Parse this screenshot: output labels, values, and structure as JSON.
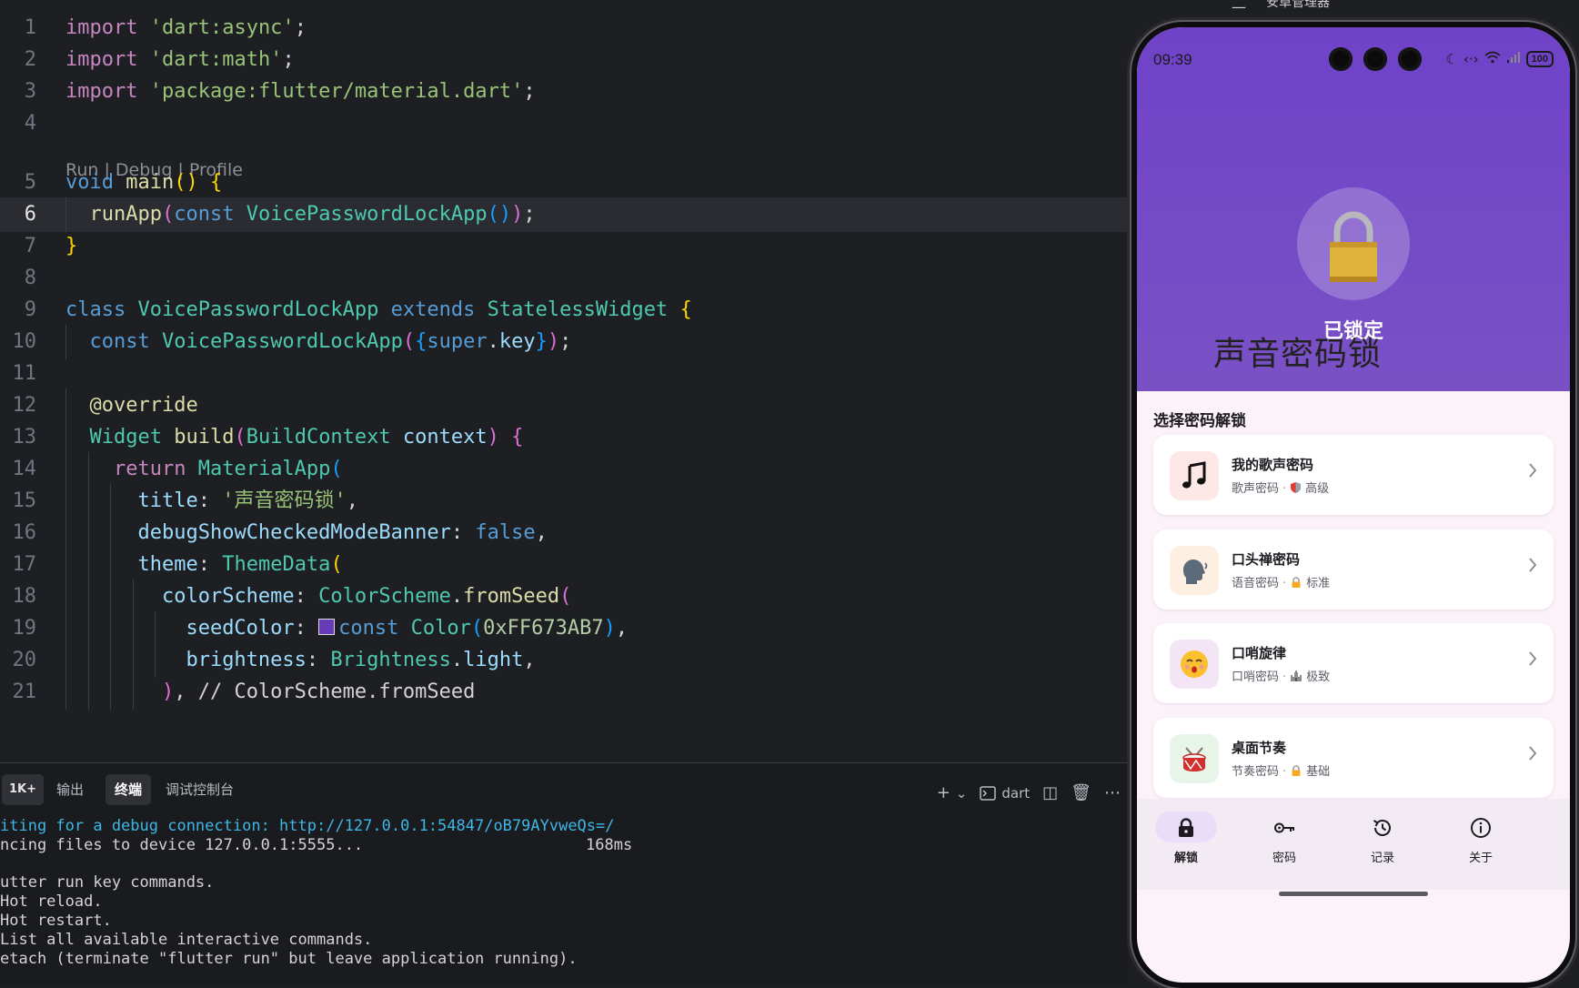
{
  "editor": {
    "codelens": "Run | Debug | Profile",
    "active_line": 6,
    "lines": [
      {
        "n": "1",
        "tokens": [
          [
            "kw",
            "import"
          ],
          [
            "punc",
            " "
          ],
          [
            "str2",
            "'dart:async'"
          ],
          [
            "punc",
            ";"
          ]
        ]
      },
      {
        "n": "2",
        "tokens": [
          [
            "kw",
            "import"
          ],
          [
            "punc",
            " "
          ],
          [
            "str2",
            "'dart:math'"
          ],
          [
            "punc",
            ";"
          ]
        ]
      },
      {
        "n": "3",
        "tokens": [
          [
            "kw",
            "import"
          ],
          [
            "punc",
            " "
          ],
          [
            "str2",
            "'package:flutter/material.dart'"
          ],
          [
            "punc",
            ";"
          ]
        ]
      },
      {
        "n": "4",
        "tokens": []
      },
      {
        "n": "5",
        "tokens": [
          [
            "kw2",
            "void"
          ],
          [
            "punc",
            " "
          ],
          [
            "fn",
            "main"
          ],
          [
            "brk1",
            "()"
          ],
          [
            "punc",
            " "
          ],
          [
            "brk1",
            "{"
          ]
        ]
      },
      {
        "n": "6",
        "tokens": [
          [
            "punc",
            "  "
          ],
          [
            "fn",
            "runApp"
          ],
          [
            "brk2",
            "("
          ],
          [
            "kw2",
            "const"
          ],
          [
            "punc",
            " "
          ],
          [
            "cls",
            "VoicePasswordLockApp"
          ],
          [
            "brk3",
            "()"
          ],
          [
            "brk2",
            ")"
          ],
          [
            "punc",
            ";"
          ]
        ]
      },
      {
        "n": "7",
        "tokens": [
          [
            "brk1",
            "}"
          ]
        ]
      },
      {
        "n": "8",
        "tokens": []
      },
      {
        "n": "9",
        "tokens": [
          [
            "kw2",
            "class"
          ],
          [
            "punc",
            " "
          ],
          [
            "cls",
            "VoicePasswordLockApp"
          ],
          [
            "punc",
            " "
          ],
          [
            "kw2",
            "extends"
          ],
          [
            "punc",
            " "
          ],
          [
            "cls",
            "StatelessWidget"
          ],
          [
            "punc",
            " "
          ],
          [
            "brk1",
            "{"
          ]
        ]
      },
      {
        "n": "10",
        "tokens": [
          [
            "punc",
            "  "
          ],
          [
            "kw2",
            "const"
          ],
          [
            "punc",
            " "
          ],
          [
            "cls",
            "VoicePasswordLockApp"
          ],
          [
            "brk2",
            "("
          ],
          [
            "brk3",
            "{"
          ],
          [
            "kw2",
            "super"
          ],
          [
            "punc",
            "."
          ],
          [
            "prop",
            "key"
          ],
          [
            "brk3",
            "}"
          ],
          [
            "brk2",
            ")"
          ],
          [
            "punc",
            ";"
          ]
        ]
      },
      {
        "n": "11",
        "tokens": []
      },
      {
        "n": "12",
        "tokens": [
          [
            "punc",
            "  "
          ],
          [
            "fn",
            "@override"
          ]
        ]
      },
      {
        "n": "13",
        "tokens": [
          [
            "punc",
            "  "
          ],
          [
            "cls",
            "Widget"
          ],
          [
            "punc",
            " "
          ],
          [
            "fn",
            "build"
          ],
          [
            "brk2",
            "("
          ],
          [
            "cls",
            "BuildContext"
          ],
          [
            "punc",
            " "
          ],
          [
            "prop",
            "context"
          ],
          [
            "brk2",
            ")"
          ],
          [
            "punc",
            " "
          ],
          [
            "brk2",
            "{"
          ]
        ]
      },
      {
        "n": "14",
        "tokens": [
          [
            "punc",
            "    "
          ],
          [
            "kw",
            "return"
          ],
          [
            "punc",
            " "
          ],
          [
            "cls",
            "MaterialApp"
          ],
          [
            "brk3",
            "("
          ]
        ]
      },
      {
        "n": "15",
        "tokens": [
          [
            "punc",
            "      "
          ],
          [
            "prop",
            "title"
          ],
          [
            "punc",
            ": "
          ],
          [
            "str2",
            "'声音密码锁'"
          ],
          [
            "punc",
            ","
          ]
        ]
      },
      {
        "n": "16",
        "tokens": [
          [
            "punc",
            "      "
          ],
          [
            "prop",
            "debugShowCheckedModeBanner"
          ],
          [
            "punc",
            ": "
          ],
          [
            "kw2",
            "false"
          ],
          [
            "punc",
            ","
          ]
        ]
      },
      {
        "n": "17",
        "tokens": [
          [
            "punc",
            "      "
          ],
          [
            "prop",
            "theme"
          ],
          [
            "punc",
            ": "
          ],
          [
            "cls",
            "ThemeData"
          ],
          [
            "brk1",
            "("
          ]
        ]
      },
      {
        "n": "18",
        "tokens": [
          [
            "punc",
            "        "
          ],
          [
            "prop",
            "colorScheme"
          ],
          [
            "punc",
            ": "
          ],
          [
            "cls",
            "ColorScheme"
          ],
          [
            "punc",
            "."
          ],
          [
            "fn",
            "fromSeed"
          ],
          [
            "brk2",
            "("
          ]
        ]
      },
      {
        "n": "19",
        "tokens": [
          [
            "punc",
            "          "
          ],
          [
            "prop",
            "seedColor"
          ],
          [
            "punc",
            ": "
          ],
          [
            "swatch",
            ""
          ],
          [
            "kw2",
            "const"
          ],
          [
            "punc",
            " "
          ],
          [
            "cls",
            "Color"
          ],
          [
            "brk3",
            "("
          ],
          [
            "num",
            "0xFF673AB7"
          ],
          [
            "brk3",
            ")"
          ],
          [
            "punc",
            ","
          ]
        ]
      },
      {
        "n": "20",
        "tokens": [
          [
            "punc",
            "          "
          ],
          [
            "prop",
            "brightness"
          ],
          [
            "punc",
            ": "
          ],
          [
            "cls",
            "Brightness"
          ],
          [
            "punc",
            "."
          ],
          [
            "prop",
            "light"
          ],
          [
            "punc",
            ","
          ]
        ]
      },
      {
        "n": "21",
        "tokens": [
          [
            "punc",
            "        "
          ],
          [
            "brk2",
            ")"
          ],
          [
            "punc",
            ", // ColorScheme.fromSeed"
          ]
        ]
      }
    ]
  },
  "panel": {
    "badge": "1K+",
    "tabs": [
      "输出",
      "终端",
      "调试控制台"
    ],
    "active_tab": "终端",
    "tools": {
      "add": "+",
      "chevron": "⌄",
      "shell_label": "dart",
      "split": "◫",
      "trash": "🗑",
      "more": "⋯"
    },
    "terminal_lines": [
      {
        "text": "iting for a debug connection: http://127.0.0.1:54847/oB79AYvweQs=/",
        "link": true
      },
      {
        "text": "ncing files to device 127.0.0.1:5555...",
        "ms": "168ms"
      },
      {
        "text": ""
      },
      {
        "text": "utter run key commands."
      },
      {
        "text": "Hot reload."
      },
      {
        "text": "Hot restart."
      },
      {
        "text": "List all available interactive commands."
      },
      {
        "text": "etach (terminate \"flutter run\" but leave application running)."
      }
    ]
  },
  "window": {
    "title": "安卓管理器"
  },
  "phone": {
    "time": "09:39",
    "battery": "100",
    "status_icons": [
      "moon-icon",
      "data-transfer-icon",
      "wifi-icon",
      "signal-icon"
    ],
    "lock_status": "已锁定",
    "app_title": "声音密码锁",
    "section_title": "选择密码解锁",
    "cards": [
      {
        "title": "我的歌声密码",
        "type": "歌声密码",
        "level_icon": "shield-icon",
        "level": "高级",
        "icon": "music-note-icon",
        "icon_bg": "#fde7e7"
      },
      {
        "title": "口头禅密码",
        "type": "语音密码",
        "level_icon": "lock-icon",
        "level": "标准",
        "icon": "speaking-head-icon",
        "icon_bg": "#fdf0e3"
      },
      {
        "title": "口哨旋律",
        "type": "口哨密码",
        "level_icon": "castle-icon",
        "level": "极致",
        "icon": "whistling-face-icon",
        "icon_bg": "#f3e5f5"
      },
      {
        "title": "桌面节奏",
        "type": "节奏密码",
        "level_icon": "lock-icon",
        "level": "基础",
        "icon": "drum-icon",
        "icon_bg": "#e8f5e9"
      }
    ],
    "nav": [
      {
        "label": "解锁",
        "icon": "lock-icon",
        "active": true
      },
      {
        "label": "密码",
        "icon": "key-icon",
        "active": false
      },
      {
        "label": "记录",
        "icon": "history-icon",
        "active": false
      },
      {
        "label": "关于",
        "icon": "info-icon",
        "active": false
      }
    ],
    "colors": {
      "primary": "#6f42c8",
      "surface": "#fbf3f9",
      "nav_pill": "#e8def8"
    }
  }
}
